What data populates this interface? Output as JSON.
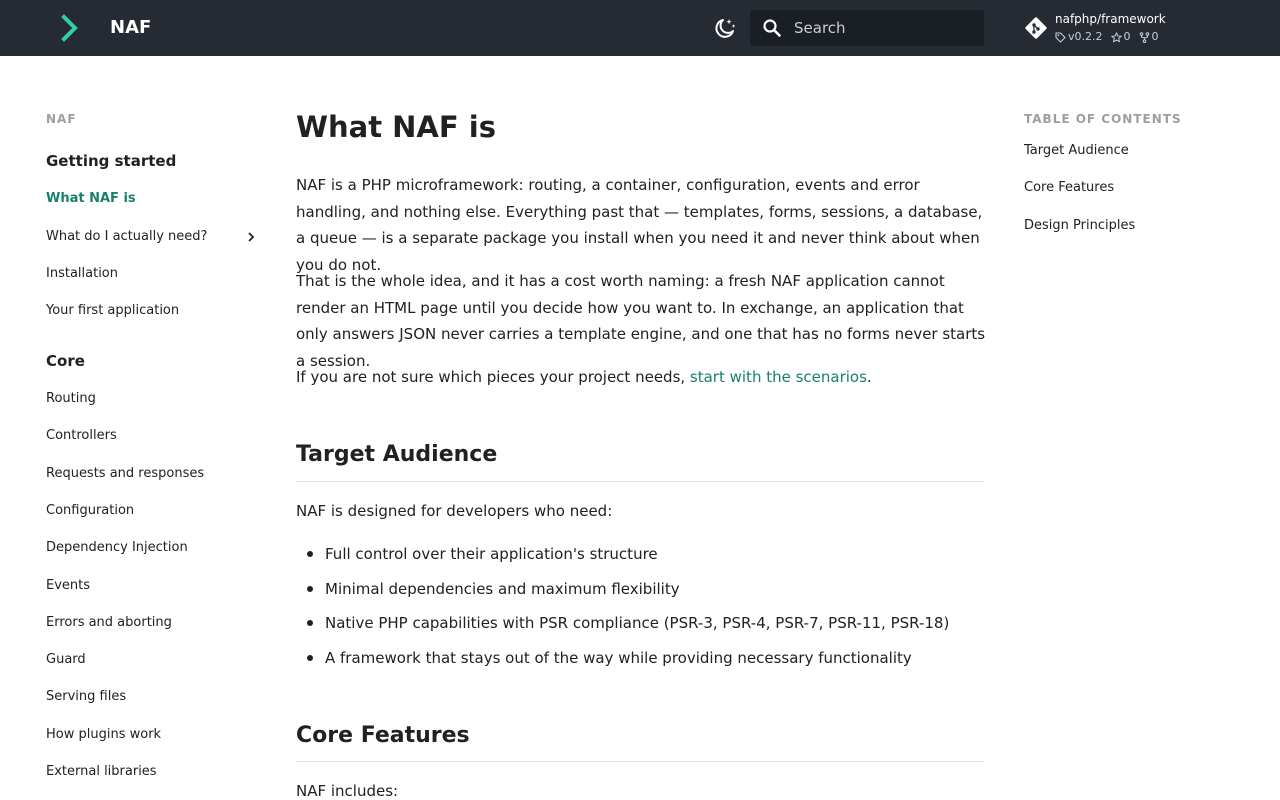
{
  "header": {
    "site_title": "NAF",
    "search_placeholder": "Search",
    "repo": {
      "name": "nafphp/framework",
      "version": "v0.2.2",
      "stars": "0",
      "forks": "0"
    },
    "icons": [
      "logo-icon",
      "theme-toggle-icon",
      "search-icon",
      "git-icon",
      "tag-icon",
      "star-icon",
      "fork-icon"
    ]
  },
  "colors": {
    "header_bg": "#252a33",
    "accent": "#19806d",
    "logo": "#2fd1a4"
  },
  "sidebar": {
    "root_label": "NAF",
    "sections": [
      {
        "title": "Getting started",
        "items": [
          {
            "label": "What NAF is",
            "active": true
          },
          {
            "label": "What do I actually need?",
            "expandable": true
          },
          {
            "label": "Installation"
          },
          {
            "label": "Your first application"
          }
        ]
      },
      {
        "title": "Core",
        "items": [
          {
            "label": "Routing"
          },
          {
            "label": "Controllers"
          },
          {
            "label": "Requests and responses"
          },
          {
            "label": "Configuration"
          },
          {
            "label": "Dependency Injection"
          },
          {
            "label": "Events"
          },
          {
            "label": "Errors and aborting"
          },
          {
            "label": "Guard"
          },
          {
            "label": "Serving files"
          },
          {
            "label": "How plugins work"
          },
          {
            "label": "External libraries"
          }
        ]
      }
    ]
  },
  "content": {
    "title": "What NAF is",
    "intro": [
      "NAF is a PHP microframework: routing, a container, configuration, events and error handling, and nothing else. Everything past that — templates, forms, sessions, a database, a queue — is a separate package you install when you need it and never think about when you do not.",
      "That is the whole idea, and it has a cost worth naming: a fresh NAF application cannot render an HTML page until you decide how you want to. In exchange, an application that only answers JSON never carries a template engine, and one that has no forms never starts a session."
    ],
    "scenario_text": "If you are not sure which pieces your project needs, ",
    "scenario_link": "start with the scenarios",
    "scenario_end": ".",
    "audience": {
      "heading": "Target Audience",
      "lead": "NAF is designed for developers who need:",
      "bullets": [
        "Full control over their application's structure",
        "Minimal dependencies and maximum flexibility",
        "Native PHP capabilities with PSR compliance (PSR-3, PSR-4, PSR-7, PSR-11, PSR-18)",
        "A framework that stays out of the way while providing necessary functionality"
      ]
    },
    "features": {
      "heading": "Core Features",
      "lead": "NAF includes:"
    }
  },
  "toc": {
    "title": "TABLE OF CONTENTS",
    "items": [
      "Target Audience",
      "Core Features",
      "Design Principles"
    ]
  }
}
